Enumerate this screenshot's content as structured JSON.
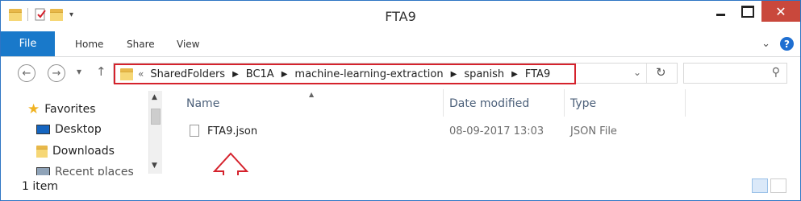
{
  "window": {
    "title": "FTA9"
  },
  "ribbon": {
    "tabs": [
      "File",
      "Home",
      "Share",
      "View"
    ]
  },
  "address": {
    "overflow_glyph": "«",
    "crumbs": [
      "SharedFolders",
      "BC1A",
      "machine-learning-extraction",
      "spanish",
      "FTA9"
    ],
    "search_placeholder": ""
  },
  "nav_pane": {
    "items": [
      {
        "label": "Favorites",
        "icon": "star-icon"
      },
      {
        "label": "Desktop",
        "icon": "desktop-icon"
      },
      {
        "label": "Downloads",
        "icon": "downloads-folder-icon"
      },
      {
        "label": "Recent places",
        "icon": "recent-places-icon"
      }
    ]
  },
  "file_list": {
    "columns": [
      "Name",
      "Date modified",
      "Type"
    ],
    "rows": [
      {
        "name": "FTA9.json",
        "date_modified": "08-09-2017 13:03",
        "type": "JSON File"
      }
    ]
  },
  "status": {
    "count": "1 item"
  },
  "colors": {
    "accent": "#1979ca",
    "annotation_red": "#d5222c",
    "close_button": "#c9483c"
  }
}
